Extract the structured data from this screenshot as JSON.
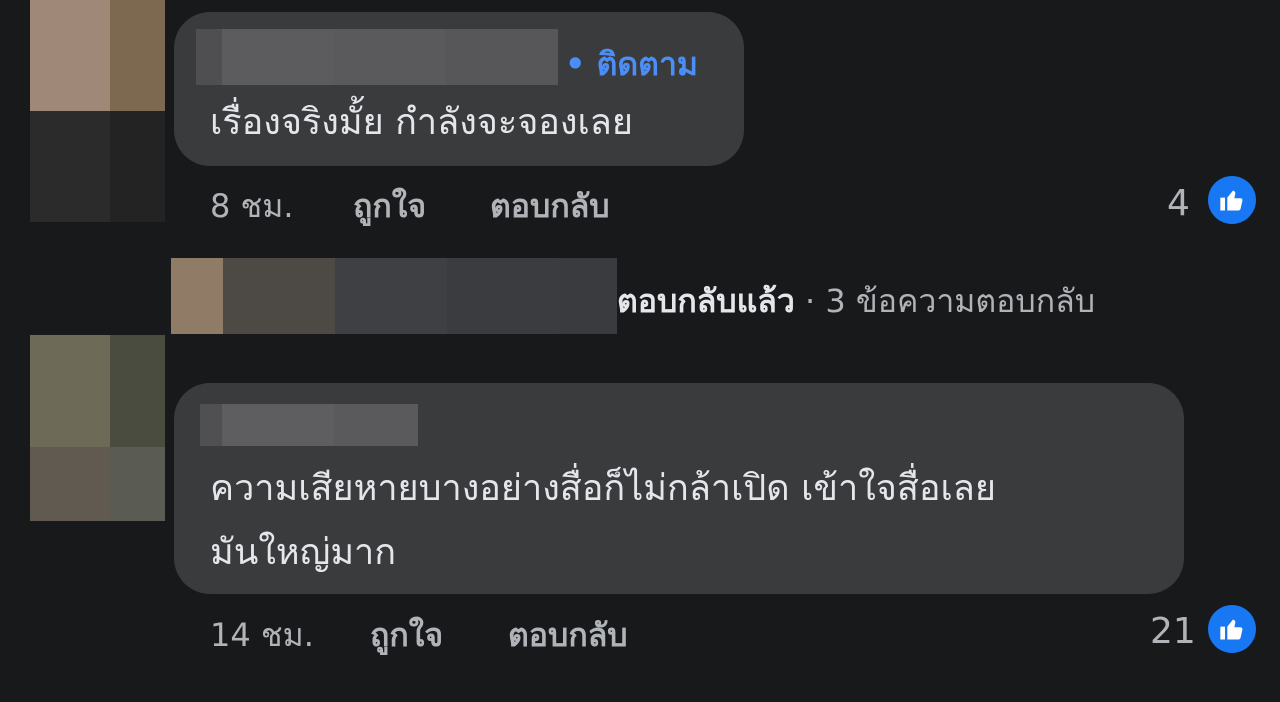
{
  "comments": [
    {
      "follow_label": "• ติดตาม",
      "text": "เรื่องจริงมั้ย กำลังจะจองเลย",
      "time": "8 ชม.",
      "like_label": "ถูกใจ",
      "reply_label": "ตอบกลับ",
      "like_count": "4"
    },
    {
      "text_line1": "ความเสียหายบางอย่างสื่อก็ไม่กล้าเปิด เข้าใจสื่อเลย",
      "text_line2": "มันใหญ่มาก",
      "time": "14 ชม.",
      "like_label": "ถูกใจ",
      "reply_label": "ตอบกลับ",
      "like_count": "21"
    }
  ],
  "replies_summary": {
    "lead": "ตอบกลับแล้ว",
    "rest": " · 3 ข้อความตอบกลับ"
  },
  "icons": {
    "like": "thumbs-up-icon"
  },
  "colors": {
    "background": "#18191a",
    "bubble": "#3a3b3c",
    "link": "#4b8ef8",
    "like_badge": "#1877f2"
  }
}
